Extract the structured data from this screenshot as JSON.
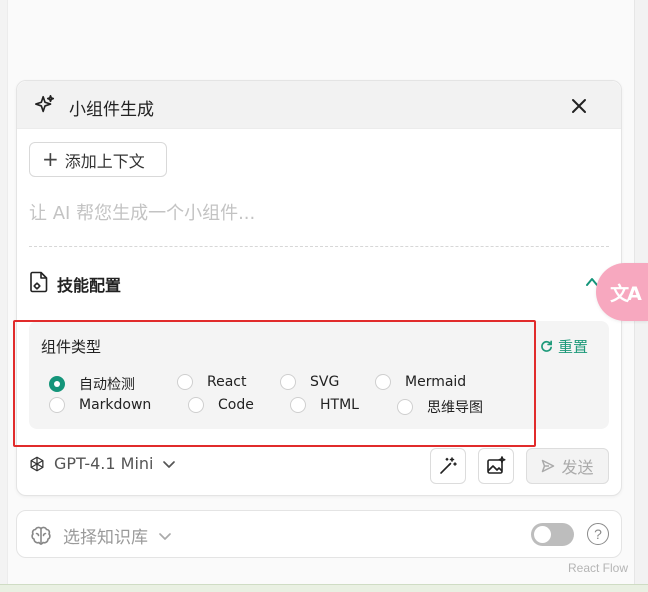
{
  "panel": {
    "title": "小组件生成",
    "add_context_label": "添加上下文",
    "prompt_placeholder": "让 AI 帮您生成一个小组件...",
    "skill_config_label": "技能配置",
    "component_type_label": "组件类型",
    "reset_label": "重置",
    "component_types": [
      {
        "label": "自动检测",
        "checked": true
      },
      {
        "label": "React",
        "checked": false
      },
      {
        "label": "SVG",
        "checked": false
      },
      {
        "label": "Mermaid",
        "checked": false
      },
      {
        "label": "Markdown",
        "checked": false
      },
      {
        "label": "Code",
        "checked": false
      },
      {
        "label": "HTML",
        "checked": false
      },
      {
        "label": "思维导图",
        "checked": false
      }
    ],
    "model_label": "GPT-4.1 Mini",
    "send_label": "发送"
  },
  "knowledge_base": {
    "select_label": "选择知识库",
    "toggle_on": false,
    "help_label": "?"
  },
  "translate_fab_label": "文A",
  "attribution": "React Flow",
  "colors": {
    "accent": "#14957a",
    "highlight_border": "#e12b2b",
    "fab": "#f7a8bf"
  }
}
